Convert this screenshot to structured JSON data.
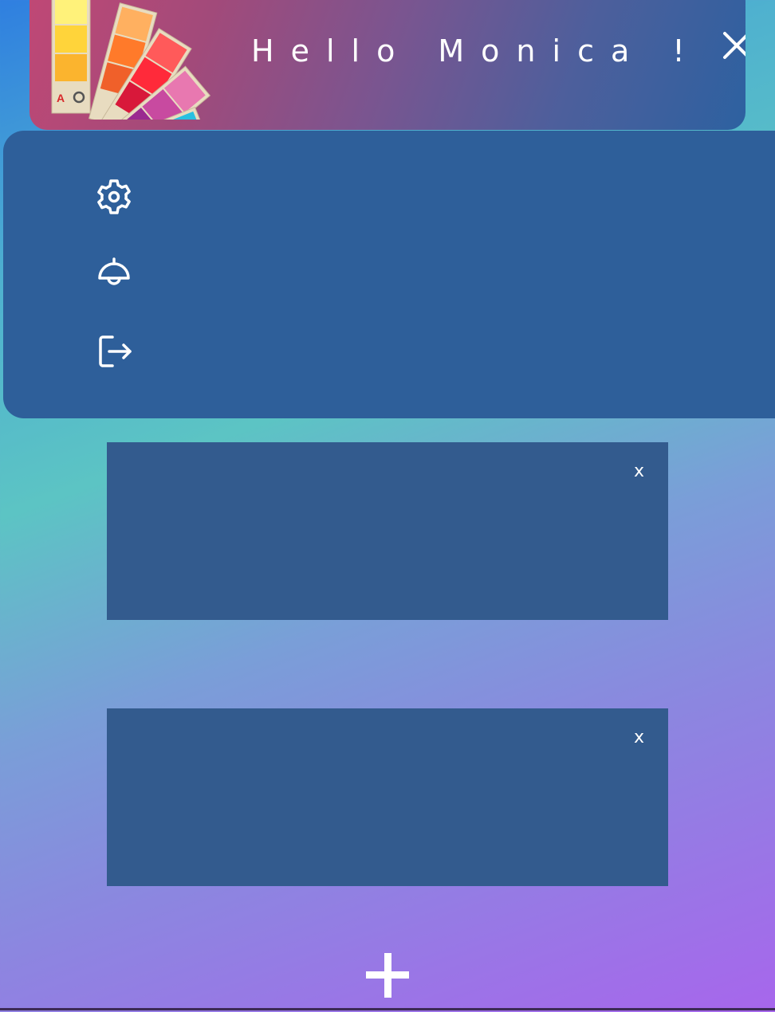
{
  "header": {
    "greeting": "Hello Monica !",
    "logo_icon": "color-swatch-fan-logo",
    "close_icon": "close-icon"
  },
  "menu": {
    "items": [
      {
        "icon": "gear-icon"
      },
      {
        "icon": "bell-icon"
      },
      {
        "icon": "logout-icon"
      }
    ]
  },
  "cards": [
    {
      "close_label": "x"
    },
    {
      "close_label": "x"
    }
  ],
  "add_button": {
    "icon": "plus-icon"
  },
  "colors": {
    "menu_bg": "#2e5f9a",
    "card_bg": "#335b8e",
    "header_start": "#c04875",
    "header_end": "#2d61a0"
  }
}
